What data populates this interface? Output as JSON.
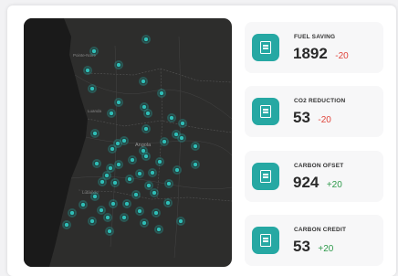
{
  "map": {
    "place_labels": [
      "Pointe-Noire",
      "Luanda",
      "Angola",
      "Lubango"
    ]
  },
  "stats": [
    {
      "label": "FUEL SAVING",
      "value": "1892",
      "delta": "-20",
      "trend": "negative"
    },
    {
      "label": "CO2 REDUCTION",
      "value": "53",
      "delta": "-20",
      "trend": "negative"
    },
    {
      "label": "CARBON OFSET",
      "value": "924",
      "delta": "+20",
      "trend": "positive"
    },
    {
      "label": "CARBON CREDIT",
      "value": "53",
      "delta": "+20",
      "trend": "positive"
    }
  ],
  "colors": {
    "accent": "#26a8a3",
    "negative": "#e0453c",
    "positive": "#2e9a4b",
    "map_land": "#2d2d2c",
    "map_ocean": "#1a1a1a"
  },
  "icons": {
    "stat_icon": "document-icon",
    "map_marker": "location-dot-icon"
  }
}
